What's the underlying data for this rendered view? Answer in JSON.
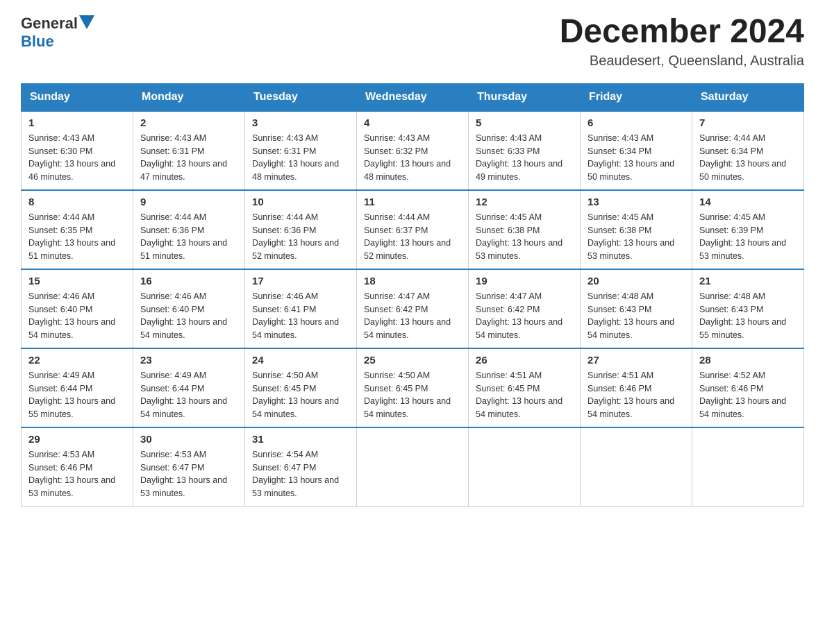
{
  "header": {
    "logo_general": "General",
    "logo_blue": "Blue",
    "month_title": "December 2024",
    "location": "Beaudesert, Queensland, Australia"
  },
  "days_of_week": [
    "Sunday",
    "Monday",
    "Tuesday",
    "Wednesday",
    "Thursday",
    "Friday",
    "Saturday"
  ],
  "weeks": [
    [
      {
        "day": "1",
        "sunrise": "4:43 AM",
        "sunset": "6:30 PM",
        "daylight": "13 hours and 46 minutes."
      },
      {
        "day": "2",
        "sunrise": "4:43 AM",
        "sunset": "6:31 PM",
        "daylight": "13 hours and 47 minutes."
      },
      {
        "day": "3",
        "sunrise": "4:43 AM",
        "sunset": "6:31 PM",
        "daylight": "13 hours and 48 minutes."
      },
      {
        "day": "4",
        "sunrise": "4:43 AM",
        "sunset": "6:32 PM",
        "daylight": "13 hours and 48 minutes."
      },
      {
        "day": "5",
        "sunrise": "4:43 AM",
        "sunset": "6:33 PM",
        "daylight": "13 hours and 49 minutes."
      },
      {
        "day": "6",
        "sunrise": "4:43 AM",
        "sunset": "6:34 PM",
        "daylight": "13 hours and 50 minutes."
      },
      {
        "day": "7",
        "sunrise": "4:44 AM",
        "sunset": "6:34 PM",
        "daylight": "13 hours and 50 minutes."
      }
    ],
    [
      {
        "day": "8",
        "sunrise": "4:44 AM",
        "sunset": "6:35 PM",
        "daylight": "13 hours and 51 minutes."
      },
      {
        "day": "9",
        "sunrise": "4:44 AM",
        "sunset": "6:36 PM",
        "daylight": "13 hours and 51 minutes."
      },
      {
        "day": "10",
        "sunrise": "4:44 AM",
        "sunset": "6:36 PM",
        "daylight": "13 hours and 52 minutes."
      },
      {
        "day": "11",
        "sunrise": "4:44 AM",
        "sunset": "6:37 PM",
        "daylight": "13 hours and 52 minutes."
      },
      {
        "day": "12",
        "sunrise": "4:45 AM",
        "sunset": "6:38 PM",
        "daylight": "13 hours and 53 minutes."
      },
      {
        "day": "13",
        "sunrise": "4:45 AM",
        "sunset": "6:38 PM",
        "daylight": "13 hours and 53 minutes."
      },
      {
        "day": "14",
        "sunrise": "4:45 AM",
        "sunset": "6:39 PM",
        "daylight": "13 hours and 53 minutes."
      }
    ],
    [
      {
        "day": "15",
        "sunrise": "4:46 AM",
        "sunset": "6:40 PM",
        "daylight": "13 hours and 54 minutes."
      },
      {
        "day": "16",
        "sunrise": "4:46 AM",
        "sunset": "6:40 PM",
        "daylight": "13 hours and 54 minutes."
      },
      {
        "day": "17",
        "sunrise": "4:46 AM",
        "sunset": "6:41 PM",
        "daylight": "13 hours and 54 minutes."
      },
      {
        "day": "18",
        "sunrise": "4:47 AM",
        "sunset": "6:42 PM",
        "daylight": "13 hours and 54 minutes."
      },
      {
        "day": "19",
        "sunrise": "4:47 AM",
        "sunset": "6:42 PM",
        "daylight": "13 hours and 54 minutes."
      },
      {
        "day": "20",
        "sunrise": "4:48 AM",
        "sunset": "6:43 PM",
        "daylight": "13 hours and 54 minutes."
      },
      {
        "day": "21",
        "sunrise": "4:48 AM",
        "sunset": "6:43 PM",
        "daylight": "13 hours and 55 minutes."
      }
    ],
    [
      {
        "day": "22",
        "sunrise": "4:49 AM",
        "sunset": "6:44 PM",
        "daylight": "13 hours and 55 minutes."
      },
      {
        "day": "23",
        "sunrise": "4:49 AM",
        "sunset": "6:44 PM",
        "daylight": "13 hours and 54 minutes."
      },
      {
        "day": "24",
        "sunrise": "4:50 AM",
        "sunset": "6:45 PM",
        "daylight": "13 hours and 54 minutes."
      },
      {
        "day": "25",
        "sunrise": "4:50 AM",
        "sunset": "6:45 PM",
        "daylight": "13 hours and 54 minutes."
      },
      {
        "day": "26",
        "sunrise": "4:51 AM",
        "sunset": "6:45 PM",
        "daylight": "13 hours and 54 minutes."
      },
      {
        "day": "27",
        "sunrise": "4:51 AM",
        "sunset": "6:46 PM",
        "daylight": "13 hours and 54 minutes."
      },
      {
        "day": "28",
        "sunrise": "4:52 AM",
        "sunset": "6:46 PM",
        "daylight": "13 hours and 54 minutes."
      }
    ],
    [
      {
        "day": "29",
        "sunrise": "4:53 AM",
        "sunset": "6:46 PM",
        "daylight": "13 hours and 53 minutes."
      },
      {
        "day": "30",
        "sunrise": "4:53 AM",
        "sunset": "6:47 PM",
        "daylight": "13 hours and 53 minutes."
      },
      {
        "day": "31",
        "sunrise": "4:54 AM",
        "sunset": "6:47 PM",
        "daylight": "13 hours and 53 minutes."
      },
      null,
      null,
      null,
      null
    ]
  ]
}
